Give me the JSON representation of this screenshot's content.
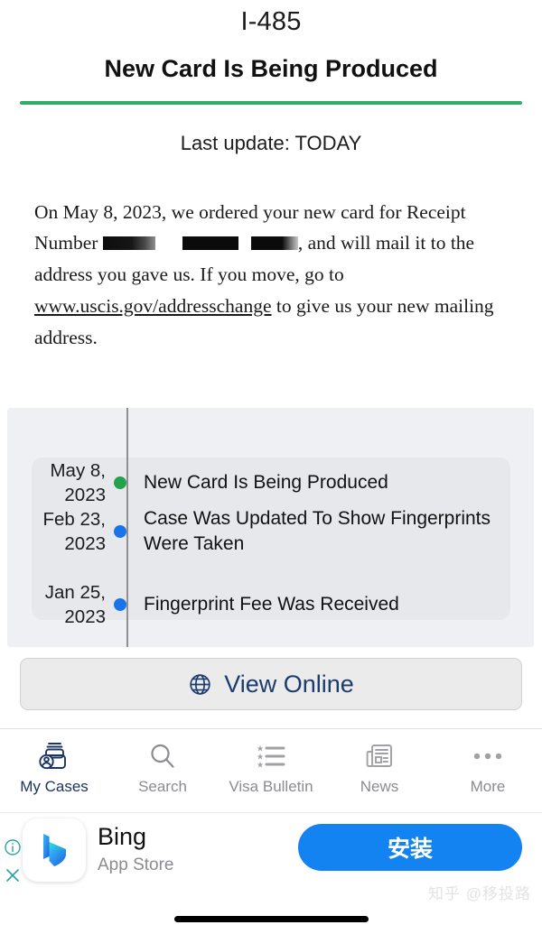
{
  "header": {
    "form_code": "I-485",
    "status_title": "New Card Is Being Produced",
    "last_update": "Last update: TODAY",
    "rule_color": "#2eac68"
  },
  "body": {
    "text_part_1": "On May 8, 2023, we ordered your new card for Receipt Number ",
    "text_part_2": ", and will mail it to the address you gave us. If you move, go to ",
    "link_text": "www.uscis.gov/addresschange",
    "text_part_3": " to give us your new mailing address.",
    "redactions": [
      "redaction-bar-1",
      "redaction-bar-2",
      "redaction-bar-3"
    ]
  },
  "timeline": {
    "events": [
      {
        "date_line1": "May 8,",
        "date_line2": "2023",
        "label": "New Card Is Being Produced",
        "dot_color": "#23a14b"
      },
      {
        "date_line1": "Feb 23,",
        "date_line2": "2023",
        "label": "Case Was Updated To Show Fingerprints Were Taken",
        "dot_color": "#1a73e8"
      },
      {
        "date_line1": "Jan 25,",
        "date_line2": "2023",
        "label": "Fingerprint Fee Was Received",
        "dot_color": "#1a73e8"
      }
    ]
  },
  "view_online": {
    "label": "View Online",
    "icon": "globe-icon",
    "text_color": "#1b3c6e"
  },
  "tabbar": {
    "items": [
      {
        "label": "My Cases",
        "icon": "cases-person-icon",
        "active": true
      },
      {
        "label": "Search",
        "icon": "search-icon",
        "active": false
      },
      {
        "label": "Visa Bulletin",
        "icon": "star-list-icon",
        "active": false
      },
      {
        "label": "News",
        "icon": "newspaper-icon",
        "active": false
      },
      {
        "label": "More",
        "icon": "ellipsis-icon",
        "active": false
      }
    ],
    "active_color": "#1b3560",
    "inactive_color": "#8b8b90"
  },
  "ad": {
    "title": "Bing",
    "subtitle": "App Store",
    "install_label": "安装",
    "install_color": "#1283f0",
    "logo": "bing-logo-icon",
    "info_icon": "info-circle-icon",
    "close_icon": "close-icon"
  },
  "watermark": {
    "text": "知乎 @移投路"
  }
}
